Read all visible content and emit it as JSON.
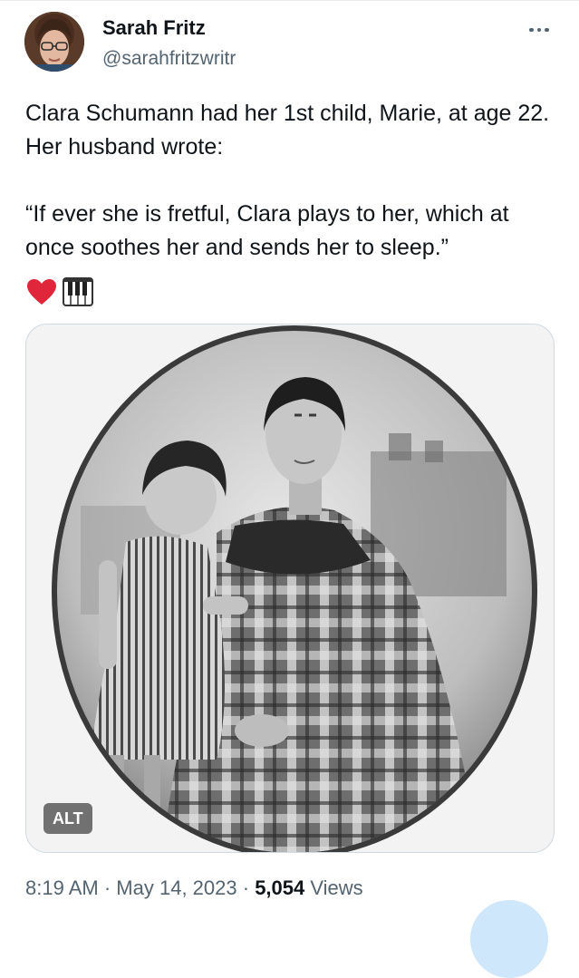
{
  "author": {
    "name": "Sarah Fritz",
    "handle": "@sarahfritzwritr"
  },
  "tweet": {
    "line1": "Clara Schumann had her 1st child, Marie, at age 22. Her husband wrote:",
    "line2": "“If ever she is fretful, Clara plays to her, which at once soothes her and sends her to sleep.”",
    "emojis": [
      "red-heart-icon",
      "piano-keys-icon"
    ]
  },
  "media": {
    "alt_label": "ALT"
  },
  "meta": {
    "time": "8:19 AM",
    "separator": "·",
    "date": "May 14, 2023",
    "views_count": "5,054",
    "views_label": "Views"
  },
  "colors": {
    "text_primary": "#0f1419",
    "text_secondary": "#536471",
    "heart": "#e0263a",
    "fab": "#cfe7fb"
  }
}
